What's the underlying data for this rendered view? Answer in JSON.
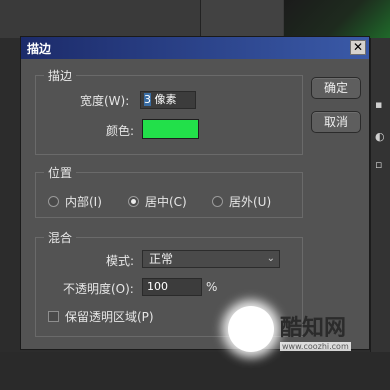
{
  "dialog": {
    "title": "描边",
    "close_glyph": "✕",
    "buttons": {
      "ok": "确定",
      "cancel": "取消"
    }
  },
  "stroke": {
    "legend": "描边",
    "width_label": "宽度(W):",
    "width_value": "3",
    "width_unit": " 像素",
    "color_label": "颜色:",
    "color": "#22e04a"
  },
  "position": {
    "legend": "位置",
    "options": [
      {
        "label": "内部(I)",
        "checked": false
      },
      {
        "label": "居中(C)",
        "checked": true
      },
      {
        "label": "居外(U)",
        "checked": false
      }
    ]
  },
  "blend": {
    "legend": "混合",
    "mode_label": "模式:",
    "mode_value": "正常",
    "opacity_label": "不透明度(O):",
    "opacity_value": "100",
    "opacity_unit": "%",
    "preserve_label": "保留透明区域(P)",
    "preserve_checked": false
  },
  "colors": {
    "title_gradient_start": "#1c2b6a",
    "title_gradient_end": "#3a5aa8",
    "dialog_bg": "#535353"
  },
  "watermark": {
    "brand": "酷知网",
    "url": "www.coozhi.com"
  }
}
